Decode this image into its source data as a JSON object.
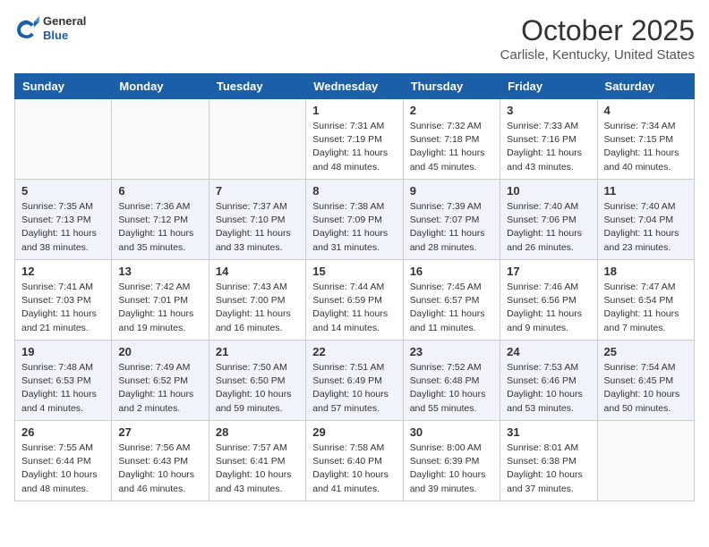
{
  "header": {
    "logo_general": "General",
    "logo_blue": "Blue",
    "title": "October 2025",
    "subtitle": "Carlisle, Kentucky, United States"
  },
  "weekdays": [
    "Sunday",
    "Monday",
    "Tuesday",
    "Wednesday",
    "Thursday",
    "Friday",
    "Saturday"
  ],
  "weeks": [
    [
      {
        "day": "",
        "info": ""
      },
      {
        "day": "",
        "info": ""
      },
      {
        "day": "",
        "info": ""
      },
      {
        "day": "1",
        "info": "Sunrise: 7:31 AM\nSunset: 7:19 PM\nDaylight: 11 hours\nand 48 minutes."
      },
      {
        "day": "2",
        "info": "Sunrise: 7:32 AM\nSunset: 7:18 PM\nDaylight: 11 hours\nand 45 minutes."
      },
      {
        "day": "3",
        "info": "Sunrise: 7:33 AM\nSunset: 7:16 PM\nDaylight: 11 hours\nand 43 minutes."
      },
      {
        "day": "4",
        "info": "Sunrise: 7:34 AM\nSunset: 7:15 PM\nDaylight: 11 hours\nand 40 minutes."
      }
    ],
    [
      {
        "day": "5",
        "info": "Sunrise: 7:35 AM\nSunset: 7:13 PM\nDaylight: 11 hours\nand 38 minutes."
      },
      {
        "day": "6",
        "info": "Sunrise: 7:36 AM\nSunset: 7:12 PM\nDaylight: 11 hours\nand 35 minutes."
      },
      {
        "day": "7",
        "info": "Sunrise: 7:37 AM\nSunset: 7:10 PM\nDaylight: 11 hours\nand 33 minutes."
      },
      {
        "day": "8",
        "info": "Sunrise: 7:38 AM\nSunset: 7:09 PM\nDaylight: 11 hours\nand 31 minutes."
      },
      {
        "day": "9",
        "info": "Sunrise: 7:39 AM\nSunset: 7:07 PM\nDaylight: 11 hours\nand 28 minutes."
      },
      {
        "day": "10",
        "info": "Sunrise: 7:40 AM\nSunset: 7:06 PM\nDaylight: 11 hours\nand 26 minutes."
      },
      {
        "day": "11",
        "info": "Sunrise: 7:40 AM\nSunset: 7:04 PM\nDaylight: 11 hours\nand 23 minutes."
      }
    ],
    [
      {
        "day": "12",
        "info": "Sunrise: 7:41 AM\nSunset: 7:03 PM\nDaylight: 11 hours\nand 21 minutes."
      },
      {
        "day": "13",
        "info": "Sunrise: 7:42 AM\nSunset: 7:01 PM\nDaylight: 11 hours\nand 19 minutes."
      },
      {
        "day": "14",
        "info": "Sunrise: 7:43 AM\nSunset: 7:00 PM\nDaylight: 11 hours\nand 16 minutes."
      },
      {
        "day": "15",
        "info": "Sunrise: 7:44 AM\nSunset: 6:59 PM\nDaylight: 11 hours\nand 14 minutes."
      },
      {
        "day": "16",
        "info": "Sunrise: 7:45 AM\nSunset: 6:57 PM\nDaylight: 11 hours\nand 11 minutes."
      },
      {
        "day": "17",
        "info": "Sunrise: 7:46 AM\nSunset: 6:56 PM\nDaylight: 11 hours\nand 9 minutes."
      },
      {
        "day": "18",
        "info": "Sunrise: 7:47 AM\nSunset: 6:54 PM\nDaylight: 11 hours\nand 7 minutes."
      }
    ],
    [
      {
        "day": "19",
        "info": "Sunrise: 7:48 AM\nSunset: 6:53 PM\nDaylight: 11 hours\nand 4 minutes."
      },
      {
        "day": "20",
        "info": "Sunrise: 7:49 AM\nSunset: 6:52 PM\nDaylight: 11 hours\nand 2 minutes."
      },
      {
        "day": "21",
        "info": "Sunrise: 7:50 AM\nSunset: 6:50 PM\nDaylight: 10 hours\nand 59 minutes."
      },
      {
        "day": "22",
        "info": "Sunrise: 7:51 AM\nSunset: 6:49 PM\nDaylight: 10 hours\nand 57 minutes."
      },
      {
        "day": "23",
        "info": "Sunrise: 7:52 AM\nSunset: 6:48 PM\nDaylight: 10 hours\nand 55 minutes."
      },
      {
        "day": "24",
        "info": "Sunrise: 7:53 AM\nSunset: 6:46 PM\nDaylight: 10 hours\nand 53 minutes."
      },
      {
        "day": "25",
        "info": "Sunrise: 7:54 AM\nSunset: 6:45 PM\nDaylight: 10 hours\nand 50 minutes."
      }
    ],
    [
      {
        "day": "26",
        "info": "Sunrise: 7:55 AM\nSunset: 6:44 PM\nDaylight: 10 hours\nand 48 minutes."
      },
      {
        "day": "27",
        "info": "Sunrise: 7:56 AM\nSunset: 6:43 PM\nDaylight: 10 hours\nand 46 minutes."
      },
      {
        "day": "28",
        "info": "Sunrise: 7:57 AM\nSunset: 6:41 PM\nDaylight: 10 hours\nand 43 minutes."
      },
      {
        "day": "29",
        "info": "Sunrise: 7:58 AM\nSunset: 6:40 PM\nDaylight: 10 hours\nand 41 minutes."
      },
      {
        "day": "30",
        "info": "Sunrise: 8:00 AM\nSunset: 6:39 PM\nDaylight: 10 hours\nand 39 minutes."
      },
      {
        "day": "31",
        "info": "Sunrise: 8:01 AM\nSunset: 6:38 PM\nDaylight: 10 hours\nand 37 minutes."
      },
      {
        "day": "",
        "info": ""
      }
    ]
  ]
}
